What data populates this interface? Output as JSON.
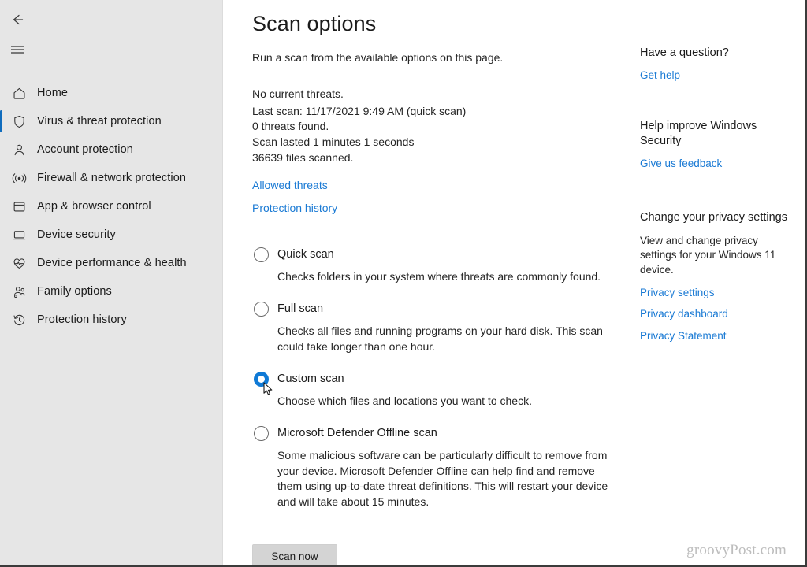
{
  "window": {
    "app_title": "Windows Security",
    "accent_color": "#0f6cbd",
    "link_color": "#1a7ad4",
    "nav_background": "#e6e6e6",
    "content_background": "#ffffff"
  },
  "nav": {
    "back_icon": "back-arrow-icon",
    "menu_icon": "hamburger-menu-icon",
    "items": [
      {
        "label": "Home",
        "icon": "home-icon",
        "selected": false
      },
      {
        "label": "Virus & threat protection",
        "icon": "shield-icon",
        "selected": true
      },
      {
        "label": "Account protection",
        "icon": "person-icon",
        "selected": false
      },
      {
        "label": "Firewall & network protection",
        "icon": "broadcast-icon",
        "selected": false
      },
      {
        "label": "App & browser control",
        "icon": "app-window-icon",
        "selected": false
      },
      {
        "label": "Device security",
        "icon": "monitor-icon",
        "selected": false
      },
      {
        "label": "Device performance & health",
        "icon": "heart-pulse-icon",
        "selected": false
      },
      {
        "label": "Family options",
        "icon": "family-people-icon",
        "selected": false
      },
      {
        "label": "Protection history",
        "icon": "history-clock-icon",
        "selected": false
      }
    ]
  },
  "main": {
    "title": "Scan options",
    "subtitle": "Run a scan from the available options on this page.",
    "status": {
      "no_threats": "No current threats.",
      "last_scan": "Last scan: 11/17/2021 9:49 AM (quick scan)",
      "threats_found": "0 threats found.",
      "scan_duration": "Scan lasted 1 minutes 1 seconds",
      "files_scanned": "36639 files scanned."
    },
    "links": {
      "allowed_threats": "Allowed threats",
      "protection_history": "Protection history"
    },
    "scan_options": [
      {
        "label": "Quick scan",
        "description": "Checks folders in your system where threats are commonly found.",
        "checked": false
      },
      {
        "label": "Full scan",
        "description": "Checks all files and running programs on your hard disk. This scan could take longer than one hour.",
        "checked": false
      },
      {
        "label": "Custom scan",
        "description": "Choose which files and locations you want to check.",
        "checked": true
      },
      {
        "label": "Microsoft Defender Offline scan",
        "description": "Some malicious software can be particularly difficult to remove from your device. Microsoft Defender Offline can help find and remove them using up-to-date threat definitions. This will restart your device and will take about 15 minutes.",
        "checked": false
      }
    ],
    "scan_now_label": "Scan now"
  },
  "rail": {
    "sections": [
      {
        "heading": "Have a question?",
        "body": "",
        "links": [
          "Get help"
        ]
      },
      {
        "heading": "Help improve Windows Security",
        "body": "",
        "links": [
          "Give us feedback"
        ]
      },
      {
        "heading": "Change your privacy settings",
        "body": "View and change privacy settings for your Windows 11 device.",
        "links": [
          "Privacy settings",
          "Privacy dashboard",
          "Privacy Statement"
        ]
      }
    ]
  },
  "watermark": {
    "text": "groovyPost.com"
  }
}
